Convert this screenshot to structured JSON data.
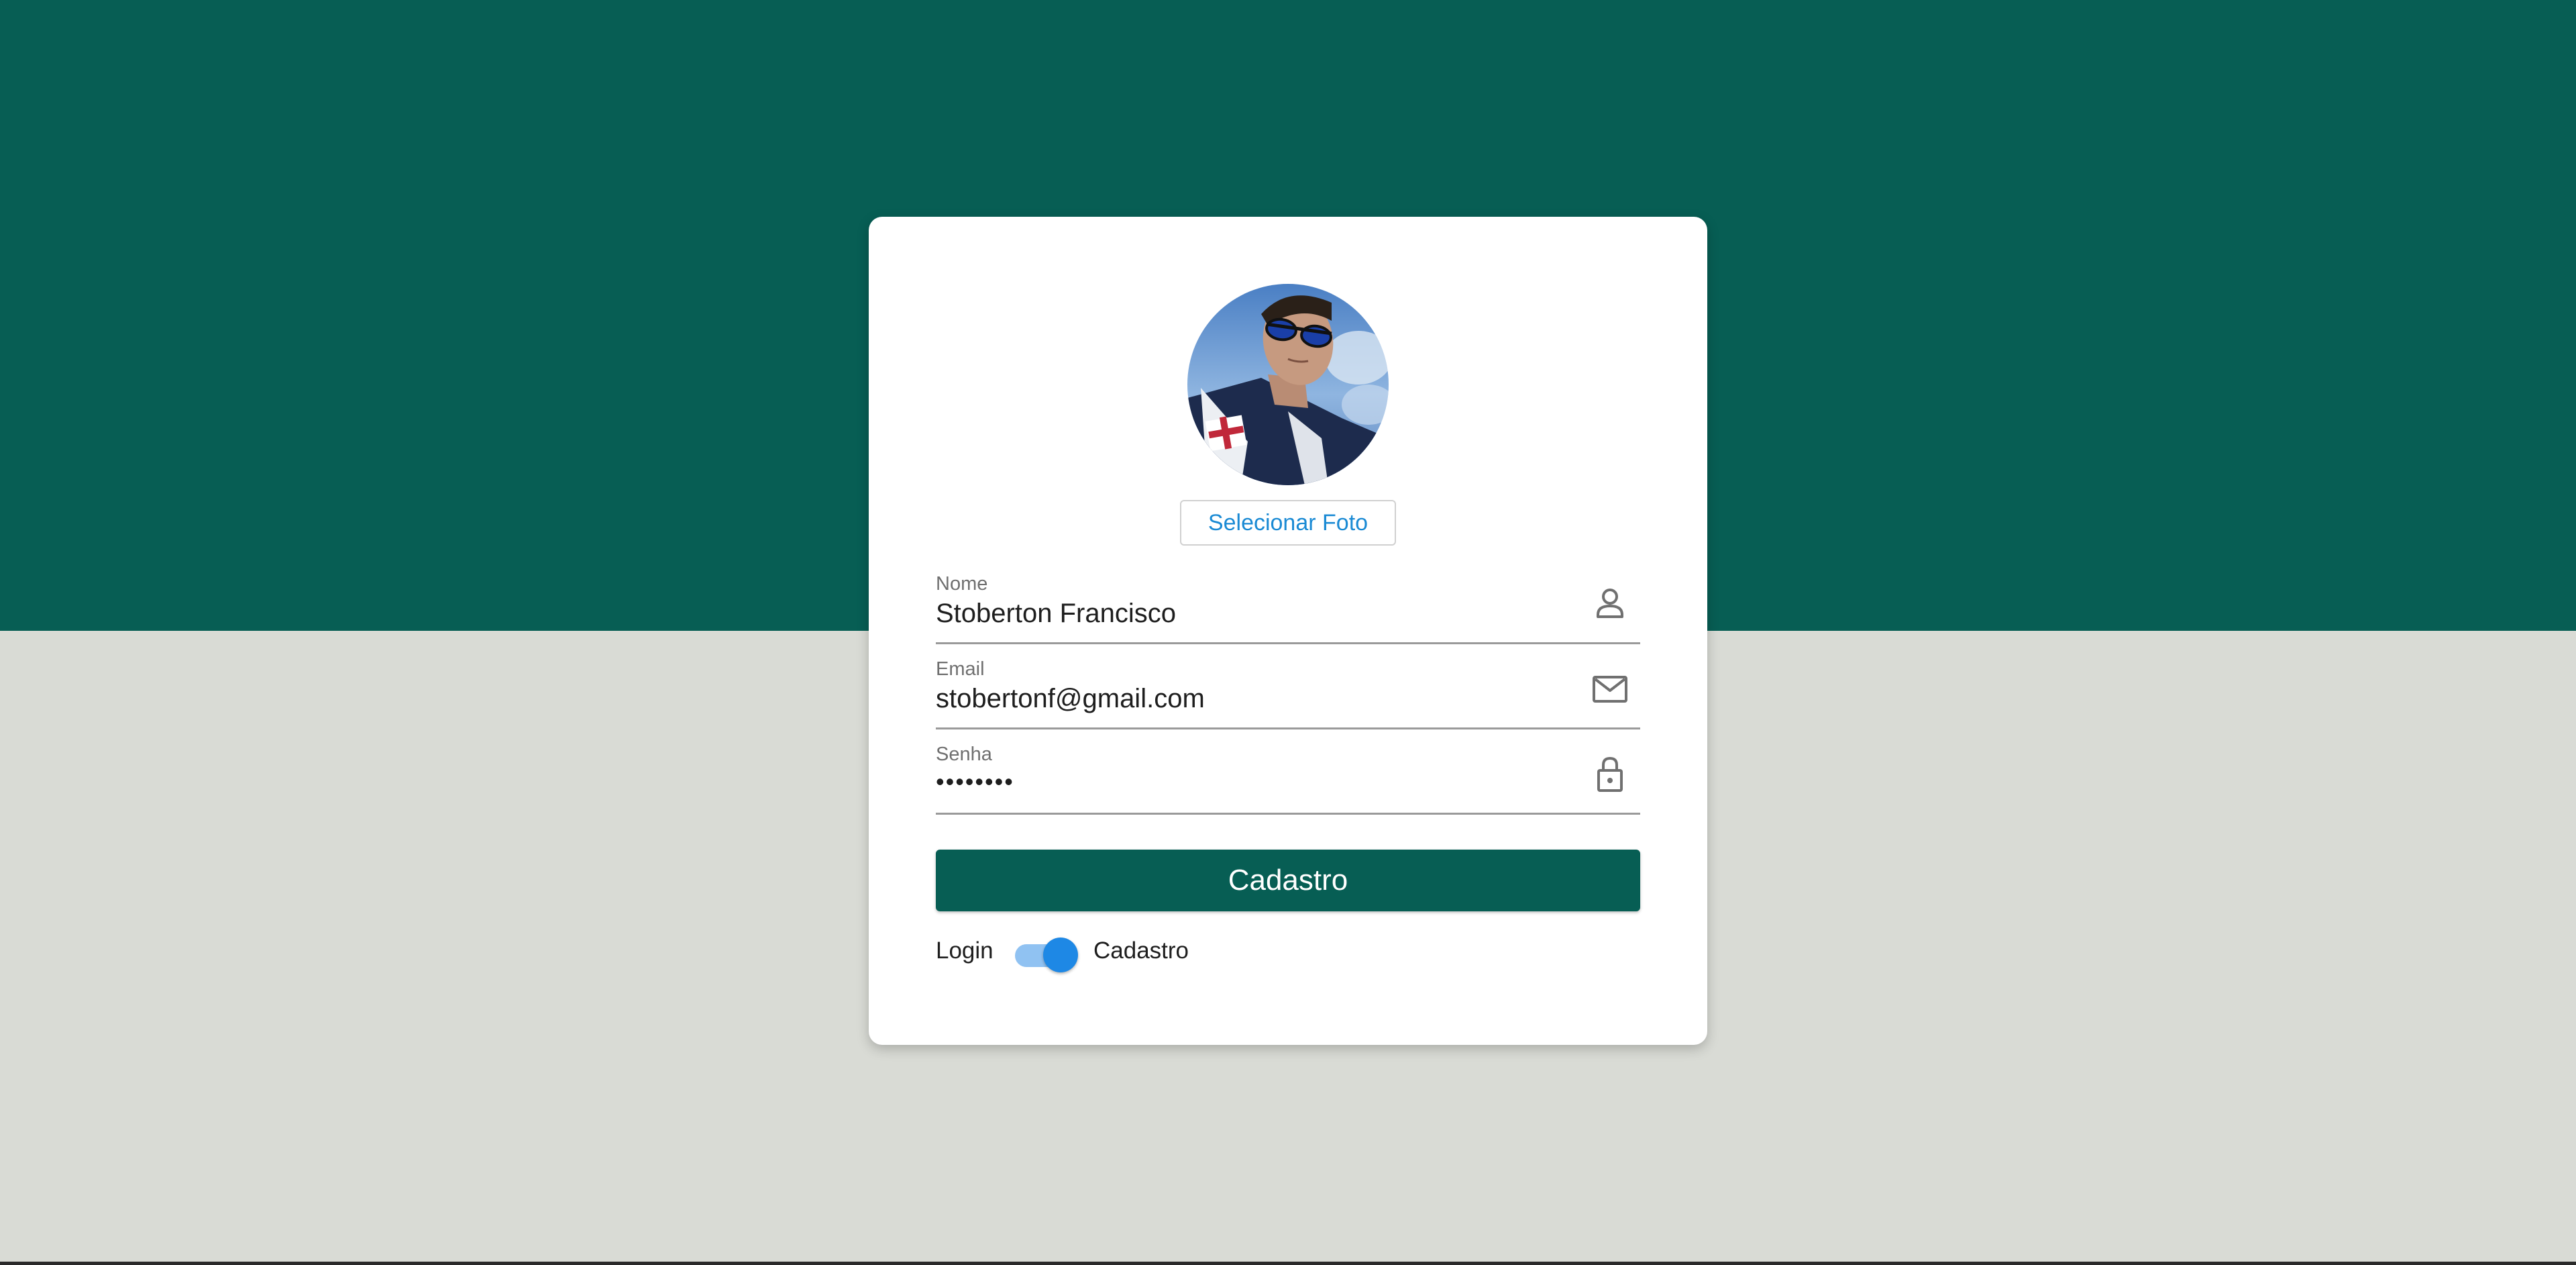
{
  "photo_button": {
    "label": "Selecionar Foto"
  },
  "fields": {
    "name": {
      "label": "Nome",
      "value": "Stoberton Francisco",
      "icon": "person-icon"
    },
    "email": {
      "label": "Email",
      "value": "stobertonf@gmail.com",
      "icon": "mail-icon"
    },
    "password": {
      "label": "Senha",
      "value": "••••••••",
      "icon": "lock-icon"
    }
  },
  "submit": {
    "label": "Cadastro"
  },
  "mode_toggle": {
    "left_label": "Login",
    "right_label": "Cadastro",
    "state": "Cadastro"
  },
  "colors": {
    "primary": "#075e54",
    "background": "#d9dbd5",
    "link": "#1a8ad4",
    "switch_thumb": "#1e88e5",
    "switch_track": "#90c2f2"
  }
}
